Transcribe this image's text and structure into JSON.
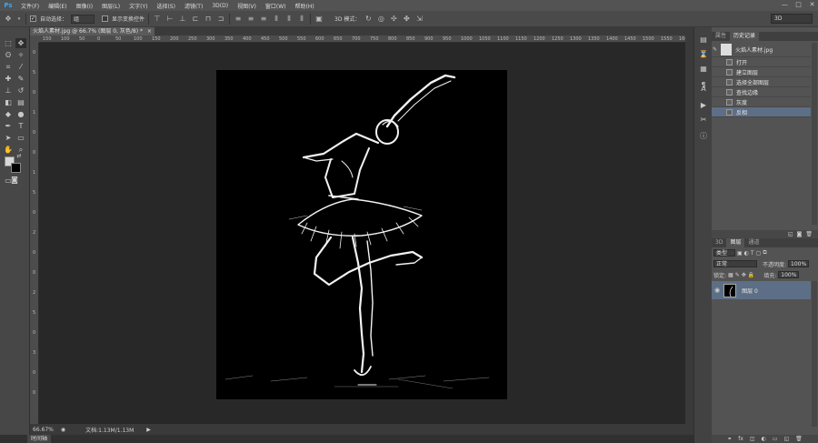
{
  "app": {
    "logo": "Ps"
  },
  "menu": [
    "文件(F)",
    "编辑(E)",
    "图像(I)",
    "图层(L)",
    "文字(Y)",
    "选择(S)",
    "滤镜(T)",
    "3D(D)",
    "视图(V)",
    "窗口(W)",
    "帮助(H)"
  ],
  "window_controls": {
    "minimize": "—",
    "maximize": "□",
    "close": "✕"
  },
  "options": {
    "auto_select_label": "自动选择：",
    "auto_select_value": "组",
    "show_transform_label": "显示变换控件",
    "mode_3d_label": "3D 模式：",
    "workspace_value": "3D"
  },
  "document": {
    "tab_title": "火焰人素材.jpg @ 66.7% (图层 0, 灰色/8) *",
    "ruler_h": [
      "150",
      "100",
      "50",
      "0",
      "50",
      "100",
      "150",
      "200",
      "250",
      "300",
      "350",
      "400",
      "450",
      "500",
      "550",
      "600",
      "650",
      "700",
      "750",
      "800",
      "850",
      "900",
      "950",
      "1000",
      "1050",
      "1100",
      "1150",
      "1200",
      "1250",
      "1300",
      "1350",
      "1400",
      "1450",
      "1500",
      "1550",
      "1600"
    ],
    "ruler_v": [
      "0",
      "5",
      "0",
      "1",
      "0",
      "0",
      "1",
      "5",
      "0",
      "2",
      "0",
      "0",
      "2",
      "5",
      "0",
      "3",
      "0",
      "0"
    ]
  },
  "status": {
    "zoom": "66.67%",
    "doc_info": "文档:1.13M/1.13M",
    "arrow": "▶"
  },
  "timeline": {
    "tab": "时间轴"
  },
  "history_panel": {
    "tabs": [
      "属性",
      "历史记录"
    ],
    "snapshot_label": "火焰人素材.jpg",
    "items": [
      "打开",
      "建立图层",
      "选择全部图层",
      "查找边缘",
      "灰度",
      "反相"
    ],
    "selected_index": 5
  },
  "layers_panel": {
    "tabs": [
      "3D",
      "图层",
      "通道"
    ],
    "filter_value": "类型",
    "blend_mode": "正常",
    "opacity_label": "不透明度:",
    "opacity_value": "100%",
    "lock_label": "锁定:",
    "fill_label": "填充:",
    "fill_value": "100%",
    "layer_name": "图层 0"
  },
  "colors": {
    "accent_selection": "#5d6f86",
    "ps_blue": "#31a8ff"
  }
}
